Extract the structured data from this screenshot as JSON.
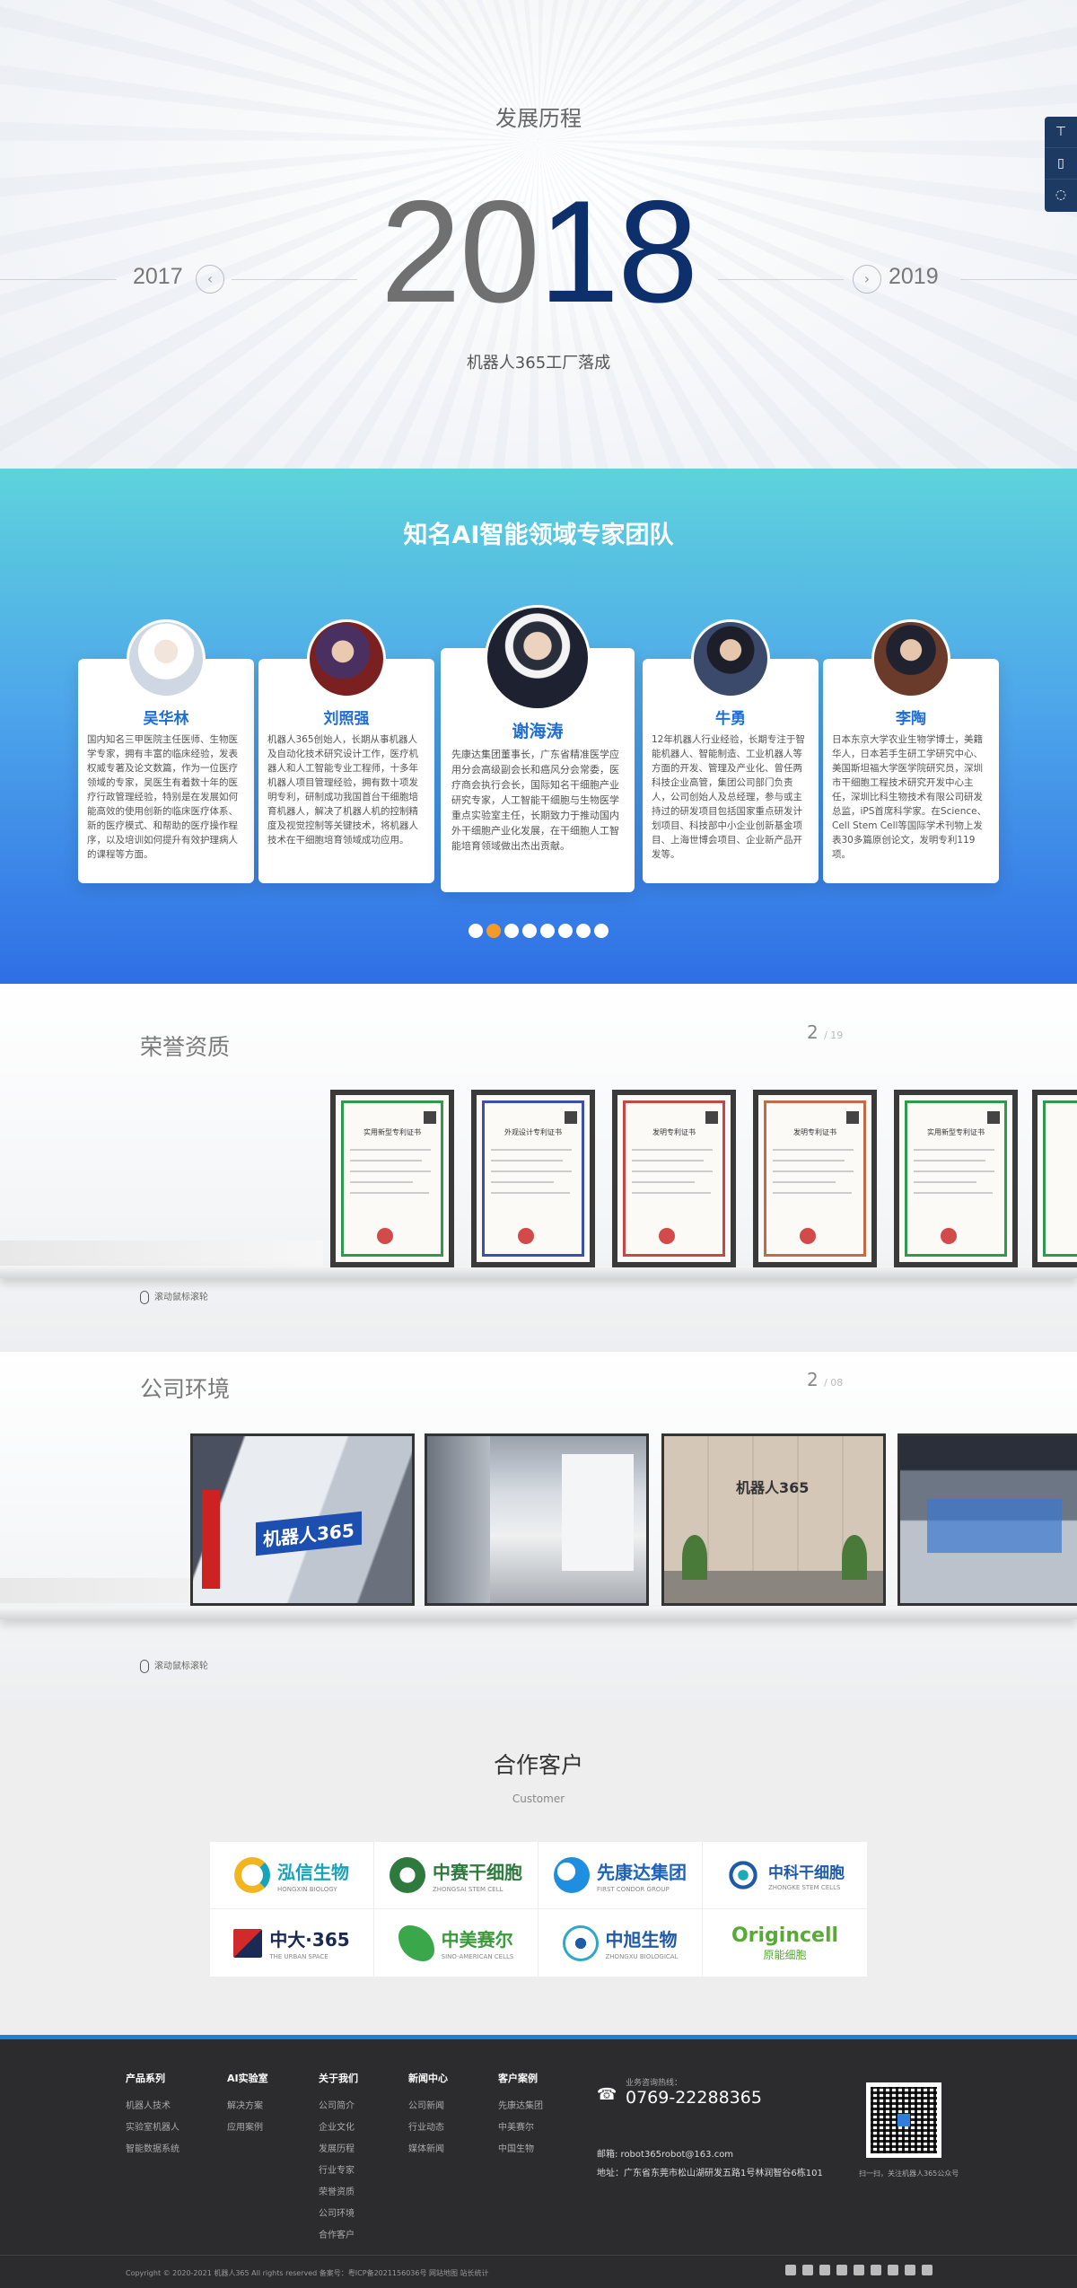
{
  "history": {
    "title": "发展历程",
    "current_year_prefix": "20",
    "current_year_suffix": "18",
    "prev_year": "2017",
    "next_year": "2019",
    "event": "机器人365工厂落成"
  },
  "sidebar": {
    "items": [
      "top-icon",
      "phone-icon",
      "wechat-icon"
    ]
  },
  "experts": {
    "title": "知名AI智能领域专家团队",
    "cards": [
      {
        "name": "吴华林",
        "desc": "国内知名三甲医院主任医师、生物医学专家，拥有丰富的临床经验，发表权威专著及论文数篇，作为一位医疗领域的专家，吴医生有着数十年的医疗行政管理经验，特别是在发展如何能高效的使用创新的临床医疗体系、新的医疗模式、和帮助的医疗操作程序，以及培训如何提升有效护理病人的课程等方面。"
      },
      {
        "name": "刘照强",
        "desc": "机器人365创始人，长期从事机器人及自动化技术研究设计工作，医疗机器人和人工智能专业工程师，十多年机器人项目管理经验，拥有数十项发明专利，研制成功我国首台干细胞培育机器人，解决了机器人机的控制精度及视觉控制等关键技术，将机器人技术在干细胞培育领域成功应用。"
      },
      {
        "name": "谢海涛",
        "desc": "先康达集团董事长，广东省精准医学应用分会高级副会长和癌风分会常委，医疗商会执行会长，国际知名干细胞产业研究专家，人工智能干细胞与生物医学重点实验室主任，长期致力于推动国内外干细胞产业化发展，在干细胞人工智能培育领域做出杰出贡献。"
      },
      {
        "name": "牛勇",
        "desc": "12年机器人行业经验，长期专注于智能机器人、智能制造、工业机器人等方面的开发、管理及产业化、曾任两科技企业高管，集团公司部门负责人，公司创始人及总经理，参与或主持过的研发项目包括国家重点研发计划项目、科技部中小企业创新基金项目、上海世博会项目、企业新产品开发等。"
      },
      {
        "name": "李陶",
        "desc": "日本东京大学农业生物学博士，美籍华人，日本若手生研工学研究中心、美国斯坦福大学医学院研究员，深圳市干细胞工程技术研究开发中心主任，深圳比科生物技术有限公司研发总监，iPS首席科学家。在Science、Cell Stem Cell等国际学术刊物上发表30多篇原创论文，发明专利119项。"
      }
    ],
    "dots": 8,
    "active_dot": 1
  },
  "honors": {
    "title": "荣誉资质",
    "page_current": "2",
    "page_total": "/ 19",
    "scroll_hint": "滚动鼠标滚轮",
    "certs": [
      {
        "title": "实用新型专利证书",
        "color": "#2f9a4f"
      },
      {
        "title": "外观设计专利证书",
        "color": "#3a4fb0"
      },
      {
        "title": "发明专利证书",
        "color": "#c44848"
      },
      {
        "title": "发明专利证书",
        "color": "#c46a48"
      },
      {
        "title": "实用新型专利证书",
        "color": "#2f9a4f"
      }
    ]
  },
  "environment": {
    "title": "公司环境",
    "page_current": "2",
    "page_total": "/ 08",
    "scroll_hint": "滚动鼠标滚轮",
    "photo_logo": "机器人365"
  },
  "customers": {
    "title": "合作客户",
    "subtitle": "Customer",
    "logos": [
      {
        "cn": "泓信生物",
        "en": "HONGXIN BIOLOGY",
        "color": "#19a3b8",
        "mark": "#f2b51f"
      },
      {
        "cn": "中赛干细胞",
        "en": "ZHONGSAI STEM CELL",
        "color": "#2e7a3e",
        "mark": "#2e7a3e"
      },
      {
        "cn": "先康达集团",
        "en": "FIRST CONDOR GROUP",
        "color": "#1f63b8",
        "mark": "#1f8ee0"
      },
      {
        "cn": "中科干细胞",
        "en": "ZHONGKE STEM CELLS",
        "color": "#1f5aa8",
        "mark": "#1fa8b8"
      },
      {
        "cn": "中大·365",
        "en": "THE URBAN SPACE",
        "color": "#1a2a55",
        "mark": "#d22a2a"
      },
      {
        "cn": "中美赛尔",
        "en": "SINO-AMERICAN CELLS",
        "color": "#3a9a3a",
        "mark": "#3aa84a"
      },
      {
        "cn": "中旭生物",
        "en": "ZHONGXU BIOLOGICAL",
        "color": "#1f5aa8",
        "mark": "#2fa8c8"
      },
      {
        "cn": "Origincell",
        "en": "原能细胞",
        "color": "#5aa838",
        "mark": "#ffffff"
      }
    ]
  },
  "footer": {
    "columns": [
      {
        "head": "产品系列",
        "items": [
          "机器人技术",
          "实验室机器人",
          "智能数据系统"
        ]
      },
      {
        "head": "AI实验室",
        "items": [
          "解决方案",
          "应用案例"
        ]
      },
      {
        "head": "关于我们",
        "items": [
          "公司简介",
          "企业文化",
          "发展历程",
          "行业专家",
          "荣誉资质",
          "公司环境",
          "合作客户"
        ]
      },
      {
        "head": "新闻中心",
        "items": [
          "公司新闻",
          "行业动态",
          "媒体新闻"
        ]
      },
      {
        "head": "客户案例",
        "items": [
          "先康达集团",
          "中美赛尔",
          "中国生物"
        ]
      }
    ],
    "hotline_label": "业务咨询热线：",
    "hotline": "0769-22288365",
    "email": "邮箱: robot365robot@163.com",
    "address": "地址：广东省东莞市松山湖研发五路1号林润智谷6栋101",
    "qr_caption": "扫一扫，关注机器人365公众号",
    "copyright": "Copyright © 2020-2021 机器人365 All rights reserved 备案号：粤ICP备2021156036号 网站地图 站长统计"
  }
}
